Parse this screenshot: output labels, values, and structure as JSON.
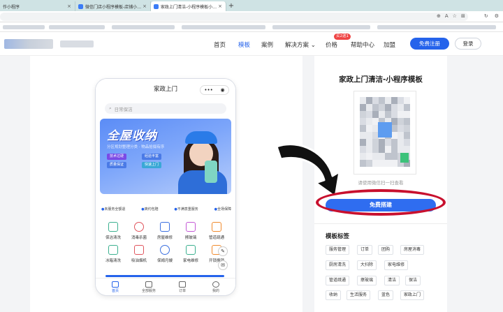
{
  "browser": {
    "tabs": [
      {
        "label": "作小程序"
      },
      {
        "label": "微信门店小程序模板-店铺小程序模"
      },
      {
        "label": "家政上门清洁-小程序模板小程序"
      }
    ],
    "new_tab": "+"
  },
  "site": {
    "nav": [
      {
        "label": "首页"
      },
      {
        "label": "模板"
      },
      {
        "label": "案例"
      },
      {
        "label": "解决方案 ⌄"
      },
      {
        "label": "价格"
      },
      {
        "label": "帮助中心"
      },
      {
        "label": "加盟"
      }
    ],
    "hot_badge": "买2送1",
    "register_label": "免费注册",
    "login_label": "登录"
  },
  "phone": {
    "title": "家政上门",
    "capsule_more": "•••",
    "capsule_close": "◉",
    "search_placeholder": "日常保洁",
    "banner": {
      "title": "全屋收纳",
      "subtitle": "分区规划整理分类 · 物品拾掇有序",
      "pills": [
        "技术过硬",
        "经验丰富",
        "质量保证",
        "快速上门"
      ]
    },
    "notices": [
      "未服务全额退",
      "爽约包赔",
      "不满意重服务",
      "全场保障"
    ],
    "services": [
      {
        "label": "保洁清洗"
      },
      {
        "label": "消毒杀菌"
      },
      {
        "label": "房屋维修"
      },
      {
        "label": "擦玻璃"
      },
      {
        "label": "管道疏通"
      },
      {
        "label": "冰箱清洗"
      },
      {
        "label": "吸油烟机"
      },
      {
        "label": "保姆月嫂"
      },
      {
        "label": "家电维修"
      },
      {
        "label": "开锁换锁"
      }
    ],
    "tabs": [
      {
        "label": "首页"
      },
      {
        "label": "全部服务"
      },
      {
        "label": "订单"
      },
      {
        "label": "我的"
      }
    ]
  },
  "template": {
    "title": "家政上门清洁-小程序模板",
    "scan_hint": "请使用微信扫一扫查看",
    "free_build_label": "免费搭建",
    "tags_title": "模板标签",
    "tags": [
      "服务管理",
      "订单",
      "团购",
      "房屋消毒",
      "厨房清洗",
      "大扫除",
      "家电维修",
      "管道疏通",
      "擦玻璃",
      "清洁",
      "保洁",
      "收纳",
      "生活服务",
      "蓝色",
      "家政上门"
    ]
  },
  "colors": {
    "accent": "#2563eb",
    "annotation_ring": "#c8102e",
    "tabbar_bg": "#cfe3e4"
  }
}
